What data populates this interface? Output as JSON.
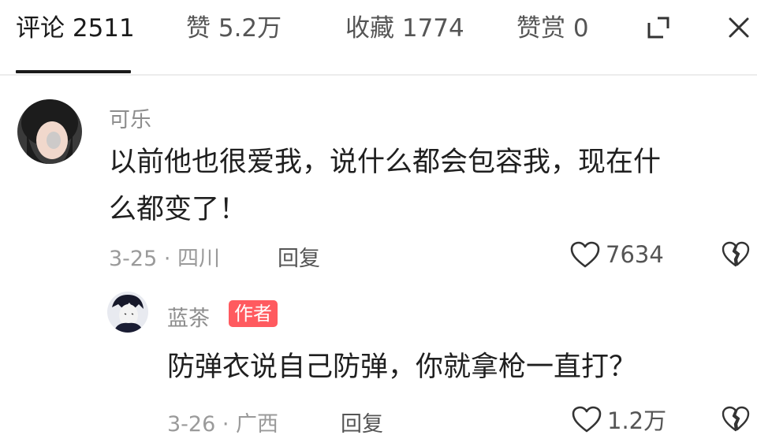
{
  "tabs": [
    {
      "label": "评论 2511",
      "active": true
    },
    {
      "label": "赞 5.2万",
      "active": false
    },
    {
      "label": "收藏 1774",
      "active": false
    },
    {
      "label": "赞赏 0",
      "active": false
    }
  ],
  "icons": {
    "expand": "expand-icon",
    "close": "close-icon",
    "like": "heart-outline-icon",
    "dislike": "broken-heart-icon"
  },
  "comment": {
    "username": "可乐",
    "text_lines": [
      "以前他也很爱我，说什么都会包容我，现在什",
      "么都变了！"
    ],
    "date_location": "3-25 · 四川",
    "reply_label": "回复",
    "likes": "7634"
  },
  "reply": {
    "username": "蓝茶",
    "badge": "作者",
    "text": "防弹衣说自己防弹，你就拿枪一直打？",
    "date_location": "3-26 · 广西",
    "reply_label": "回复",
    "likes": "1.2万"
  },
  "colors": {
    "badge_bg": "#ff5a5f",
    "username": "#8d8d8d",
    "meta": "#9a9a9a",
    "text": "#1f1f1f"
  }
}
